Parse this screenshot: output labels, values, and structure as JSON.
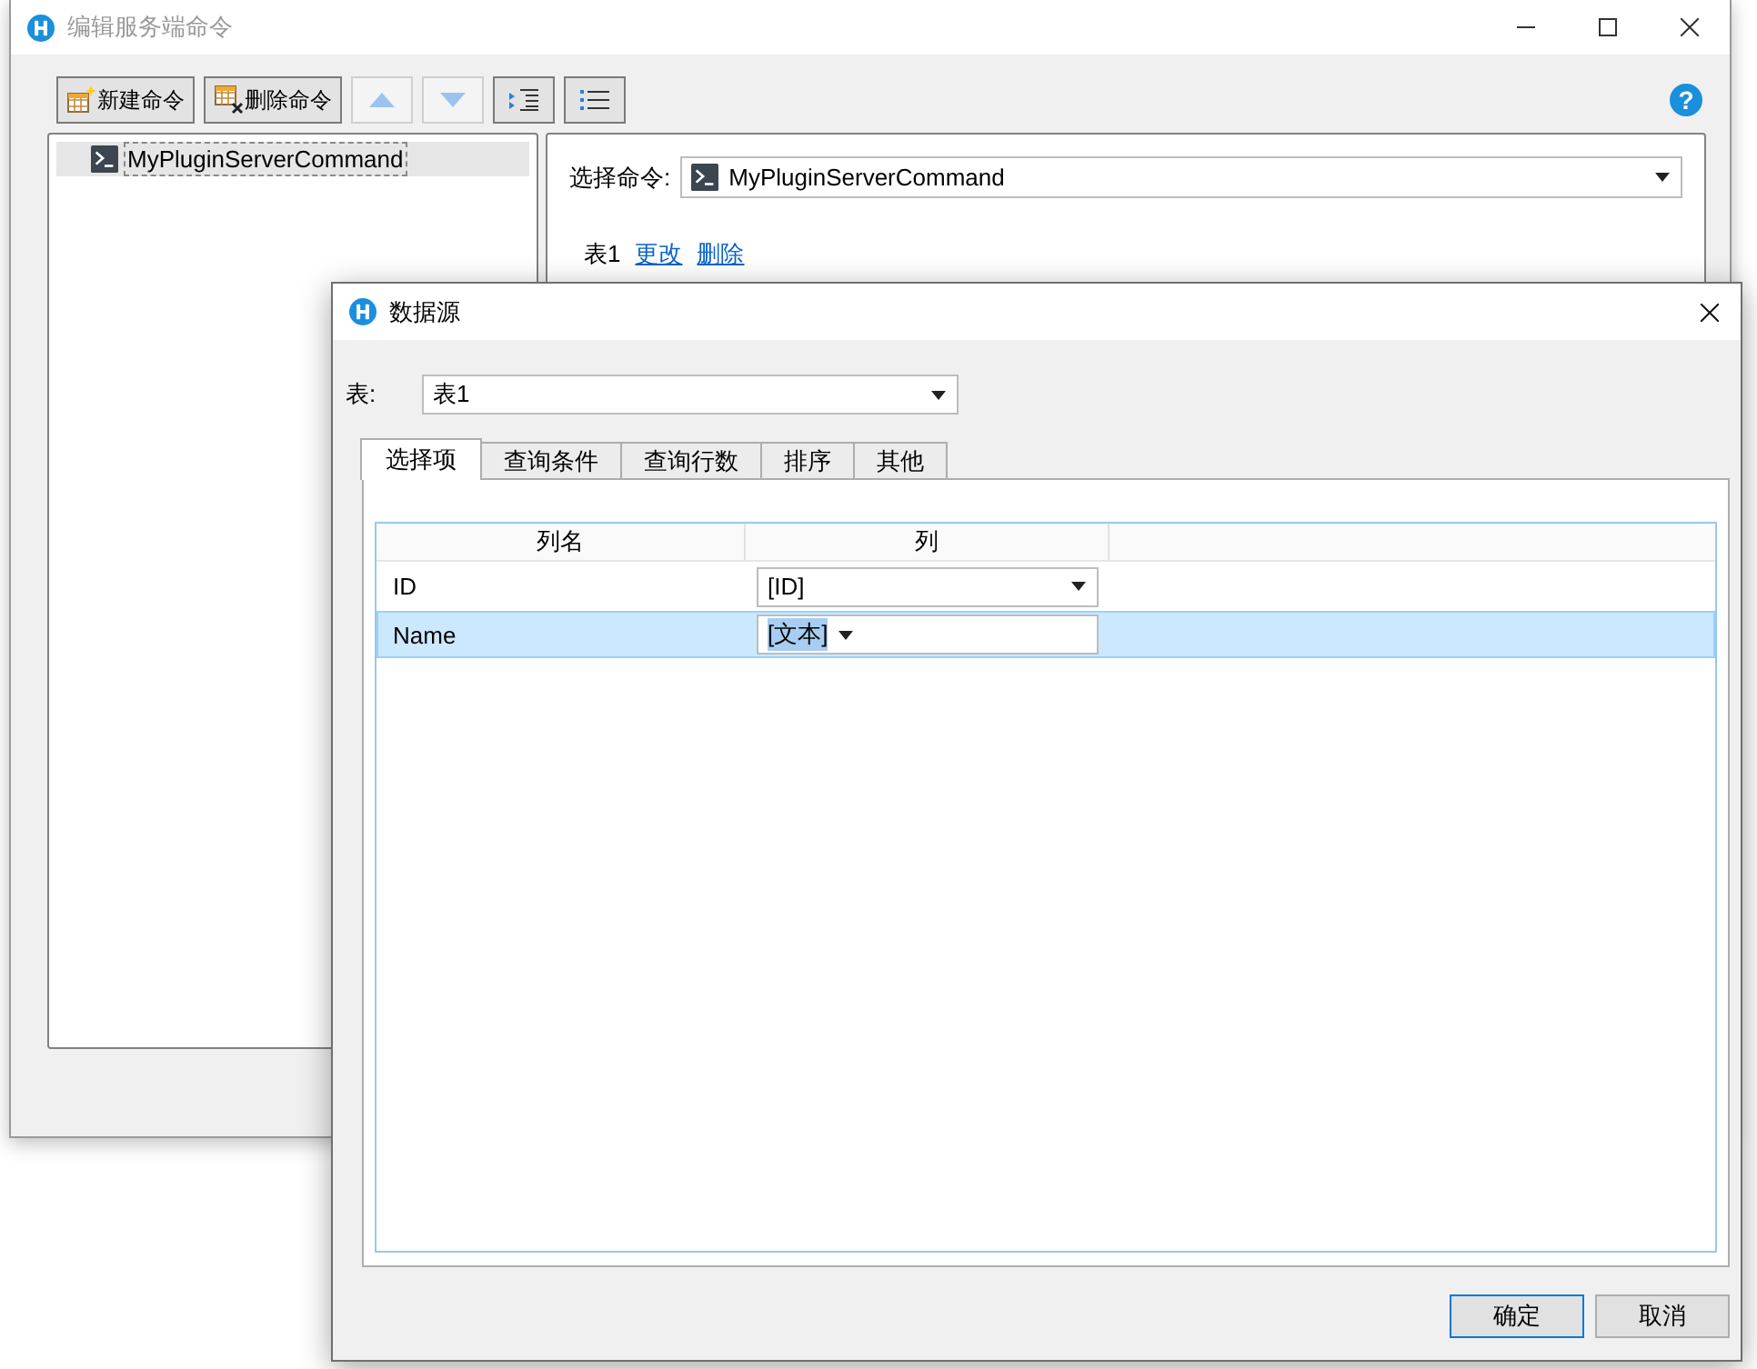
{
  "editor_window": {
    "title": "编辑服务端命令",
    "active": false
  },
  "toolbar": [
    {
      "kind": "new",
      "label": "新建命令",
      "disabled": false
    },
    {
      "kind": "delete",
      "label": "删除命令",
      "disabled": false
    },
    {
      "kind": "up",
      "disabled": true
    },
    {
      "kind": "down",
      "disabled": true
    },
    {
      "kind": "indent",
      "disabled": false
    },
    {
      "kind": "outdent",
      "disabled": false
    }
  ],
  "help": "?",
  "tree": {
    "items": [
      {
        "label": "MyPluginServerCommand",
        "selected": true
      }
    ]
  },
  "command_picker": {
    "label": "选择命令:",
    "value": "MyPluginServerCommand"
  },
  "table_links": [
    {
      "kind": "text",
      "label": "表1"
    },
    {
      "kind": "link",
      "label": "更改"
    },
    {
      "kind": "link",
      "label": "删除"
    }
  ],
  "dialog": {
    "title": "数据源",
    "active": true,
    "table_field": {
      "label": "表:",
      "value": "表1"
    },
    "tabs": [
      {
        "label": "选择项",
        "selected": true
      },
      {
        "label": "查询条件",
        "selected": false
      },
      {
        "label": "查询行数",
        "selected": false
      },
      {
        "label": "排序",
        "selected": false
      },
      {
        "label": "其他",
        "selected": false
      }
    ],
    "grid": {
      "columns": [
        "列名",
        "列"
      ],
      "rows": [
        {
          "name": "ID",
          "column": "[ID]",
          "selected": false
        },
        {
          "name": "Name",
          "column": "[文本]",
          "selected": true
        }
      ]
    },
    "buttons": [
      {
        "label": "确定",
        "default": true
      },
      {
        "label": "取消",
        "default": false
      }
    ]
  }
}
